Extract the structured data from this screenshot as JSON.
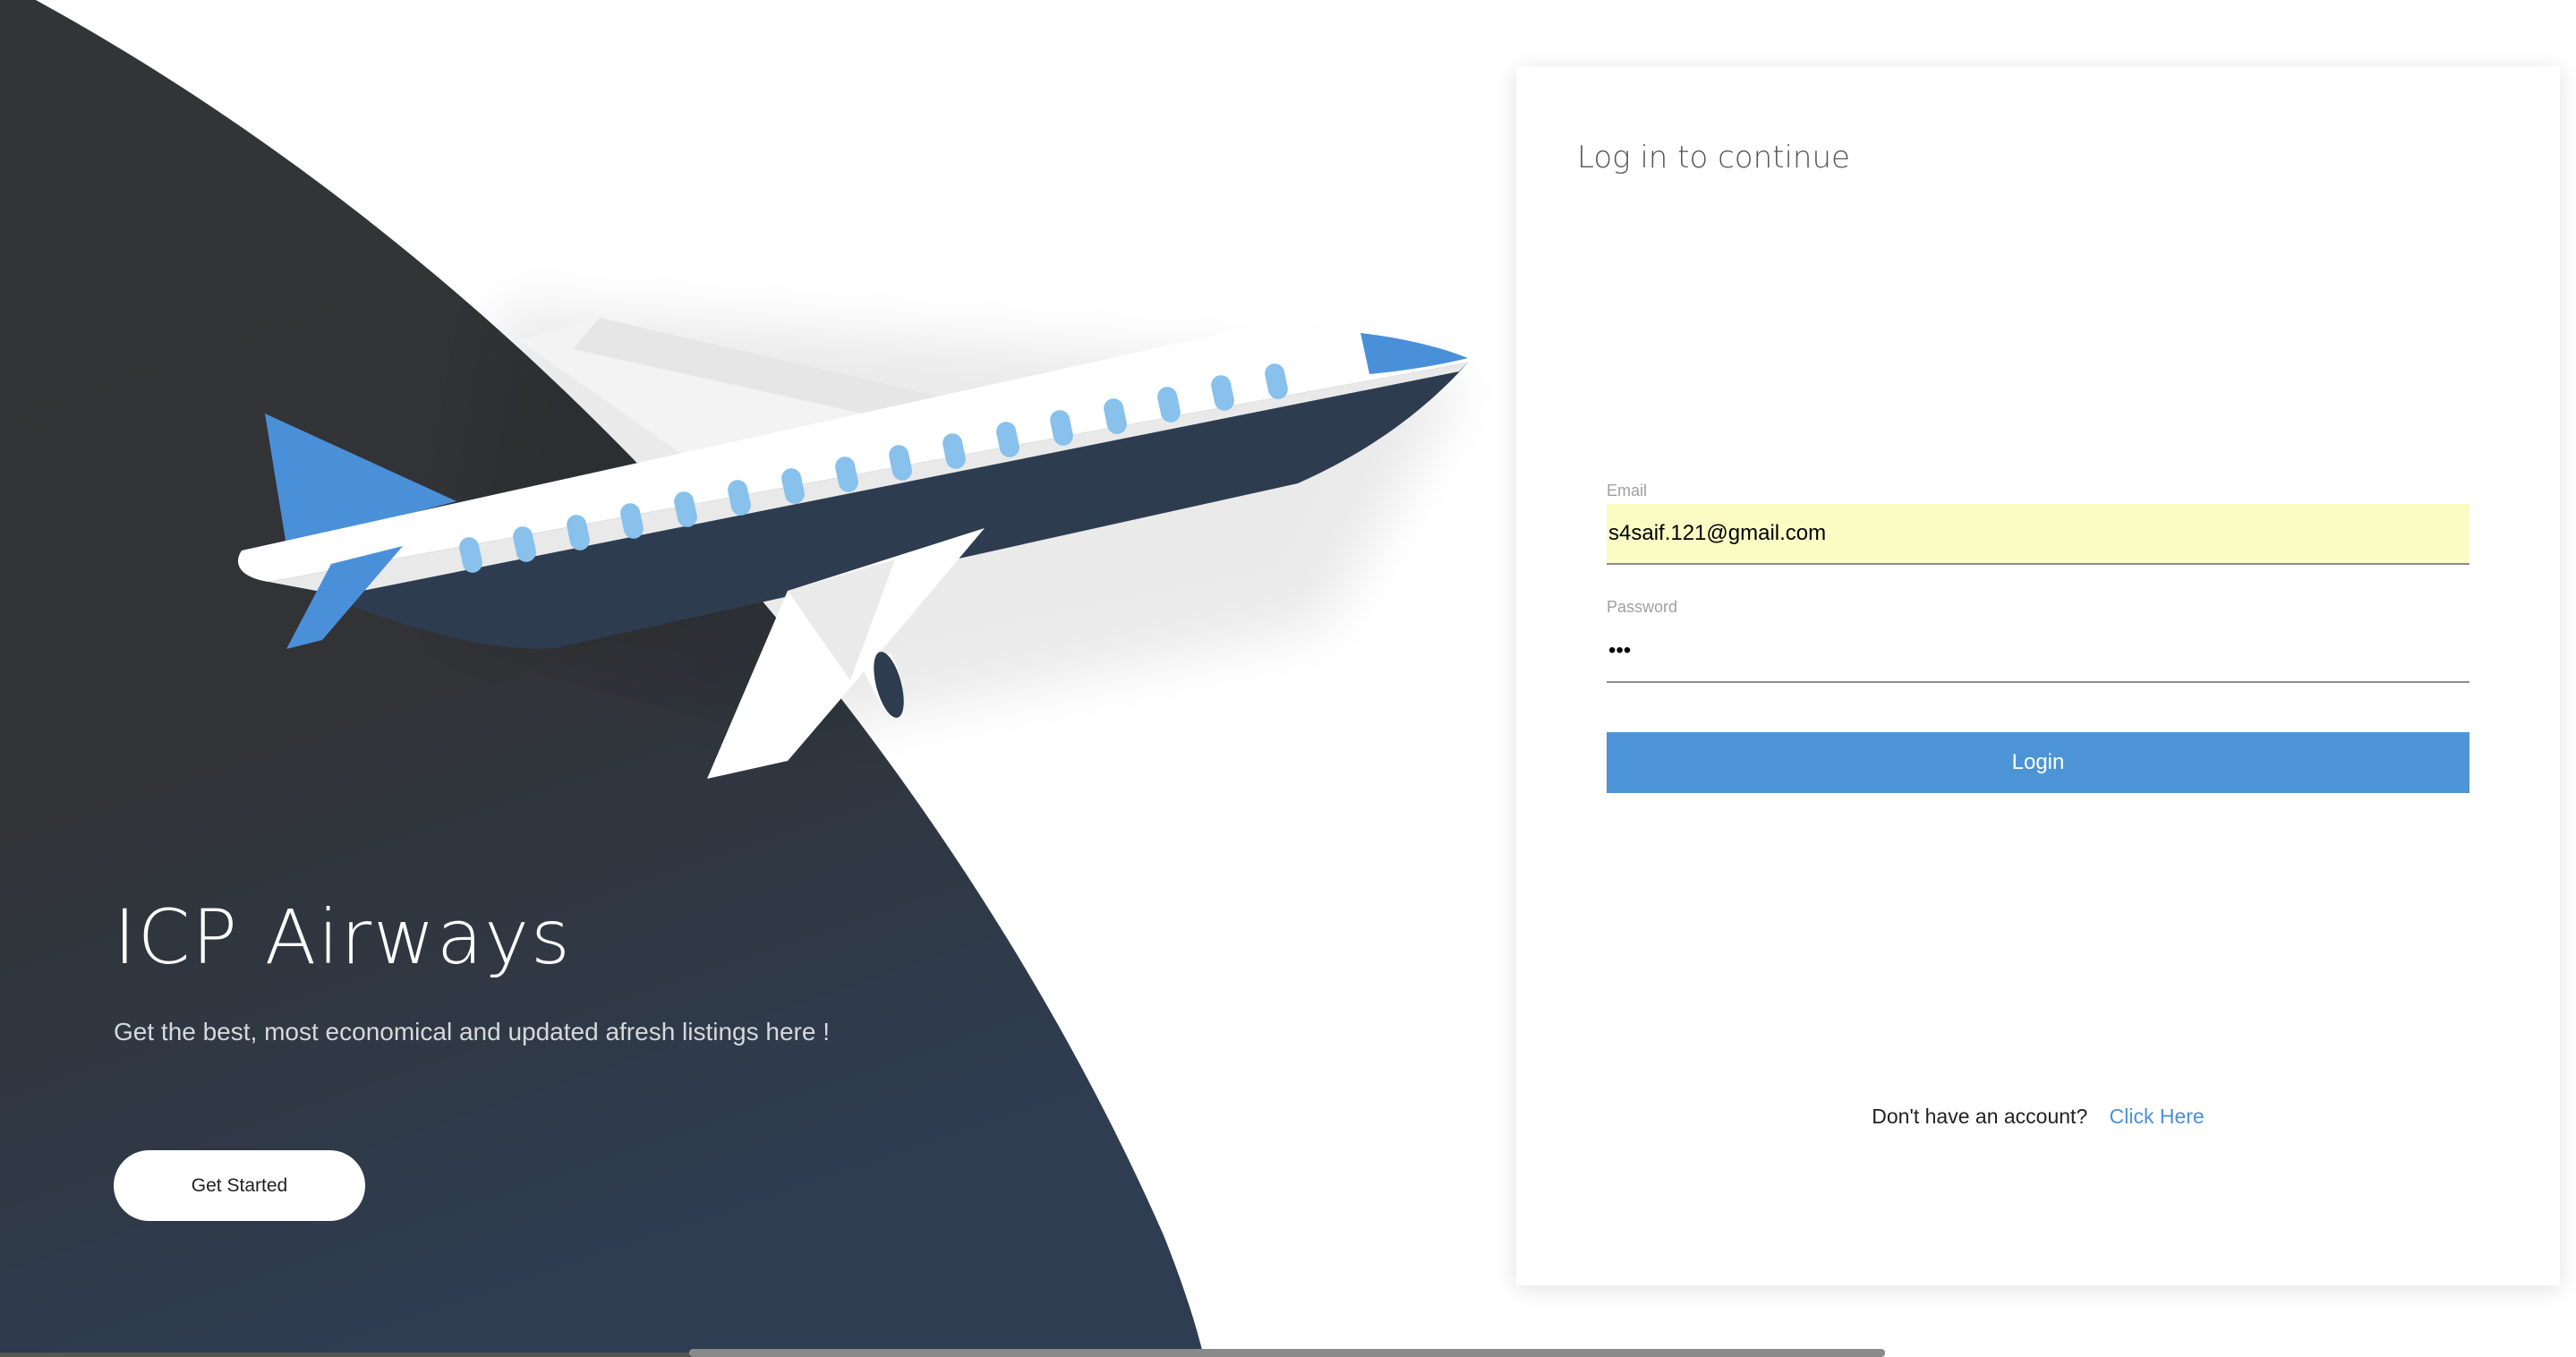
{
  "hero": {
    "title": "ICP Airways",
    "tagline": "Get the best, most economical and updated afresh listings here !",
    "cta_label": "Get Started",
    "illustration_icon": "airplane-illustration"
  },
  "login": {
    "heading": "Log in to continue",
    "email": {
      "label": "Email",
      "value": "s4saif.121@gmail.com"
    },
    "password": {
      "label": "Password",
      "value": "•••"
    },
    "submit_label": "Login",
    "signup_prompt": "Don't have an account?",
    "signup_link": "Click Here"
  },
  "colors": {
    "hero_dark": "#2f3338",
    "hero_dark_blue": "#2e3c50",
    "accent_blue": "#4d94d6",
    "window_blue": "#87c1ec",
    "autofill_yellow": "#fafcc4",
    "link_blue": "#4a90d9"
  }
}
